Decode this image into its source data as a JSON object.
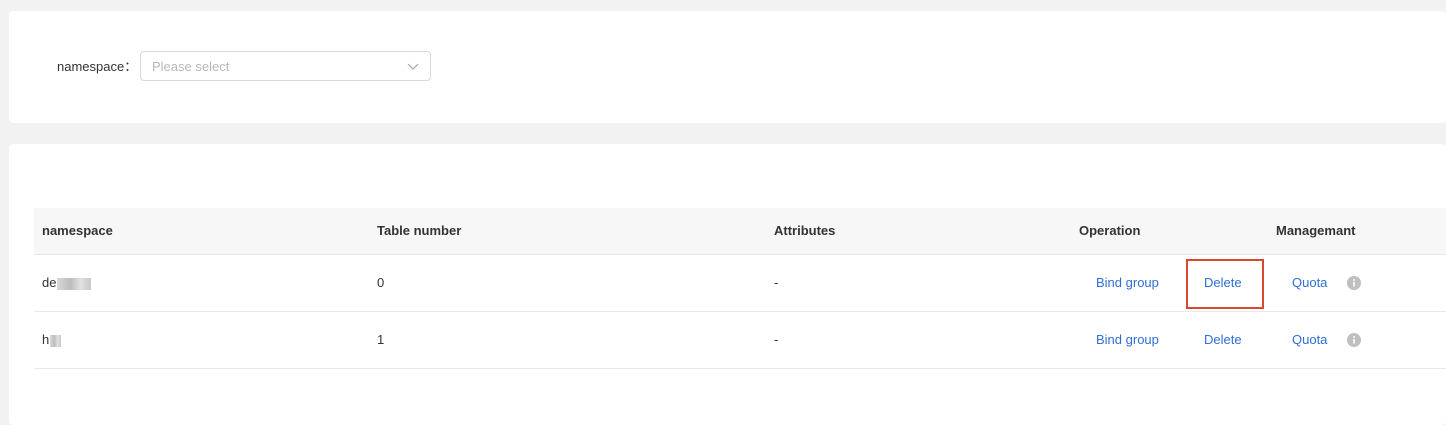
{
  "filter": {
    "label": "namespace：",
    "select_placeholder": "Please select"
  },
  "table": {
    "headers": {
      "namespace": "namespace",
      "table_number": "Table number",
      "attributes": "Attributes",
      "operation": "Operation",
      "management": "Managemant"
    },
    "rows": [
      {
        "namespace": "de",
        "table_number": "0",
        "attributes": "-",
        "bind_group": "Bind group",
        "delete": "Delete",
        "quota": "Quota"
      },
      {
        "namespace": "h",
        "table_number": "1",
        "attributes": "-",
        "bind_group": "Bind group",
        "delete": "Delete",
        "quota": "Quota"
      }
    ]
  },
  "icons": {
    "select_arrow": "chevron-down-icon",
    "quota_info": "info-icon"
  },
  "colors": {
    "link": "#2f6fd6",
    "highlight": "#d9492f",
    "header_bg": "#f7f7f7"
  }
}
